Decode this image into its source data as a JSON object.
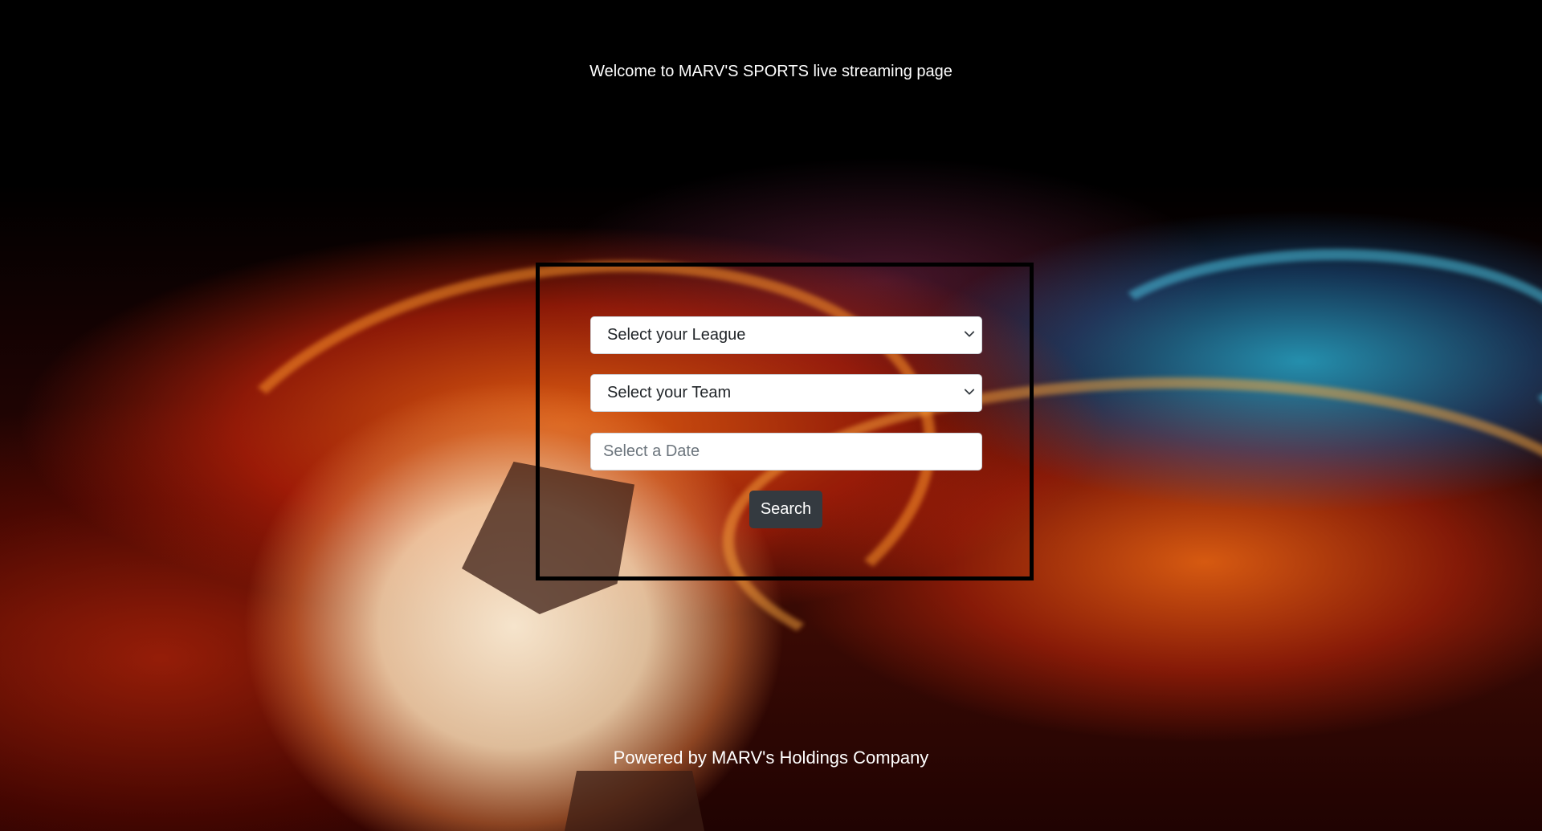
{
  "header": {
    "welcome_text": "Welcome to MARV'S SPORTS live streaming page"
  },
  "search_form": {
    "league_select": {
      "selected": "Select your League",
      "icon": "chevron-down-icon"
    },
    "team_select": {
      "selected": "Select your Team",
      "icon": "chevron-down-icon"
    },
    "date_input": {
      "placeholder": "Select a Date"
    },
    "search_button_label": "Search"
  },
  "footer": {
    "text": "Powered by MARV's Holdings Company"
  },
  "colors": {
    "button_bg": "#343a40",
    "frame_border": "#000000",
    "text": "#ffffff"
  }
}
